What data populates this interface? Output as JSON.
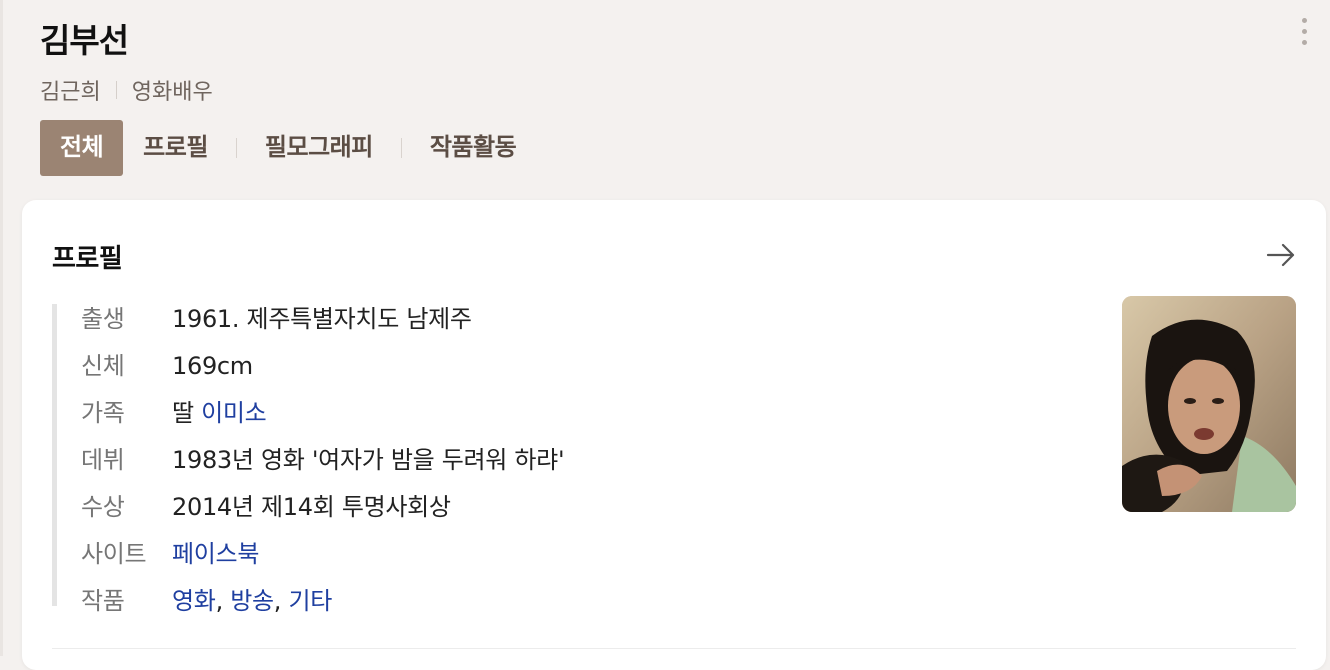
{
  "header": {
    "title": "김부선",
    "subtitle": [
      "김근희",
      "영화배우"
    ]
  },
  "tabs": [
    "전체",
    "프로필",
    "필모그래피",
    "작품활동"
  ],
  "profile": {
    "title": "프로필",
    "rows": [
      {
        "label": "출생",
        "value": "1961. 제주특별자치도 남제주"
      },
      {
        "label": "신체",
        "value": "169cm"
      },
      {
        "label": "가족",
        "prefix": "딸 ",
        "link": "이미소"
      },
      {
        "label": "데뷔",
        "value": "1983년 영화 '여자가 밤을 두려워 하랴'"
      },
      {
        "label": "수상",
        "value": "2014년 제14회 투명사회상"
      },
      {
        "label": "사이트",
        "link": "페이스북"
      },
      {
        "label": "작품",
        "links": [
          "영화",
          "방송",
          "기타"
        ],
        "separator": ", "
      }
    ]
  },
  "colors": {
    "active_tab_bg": "#9b8473",
    "link": "#1f3fa0",
    "background": "#f4f1ef"
  }
}
